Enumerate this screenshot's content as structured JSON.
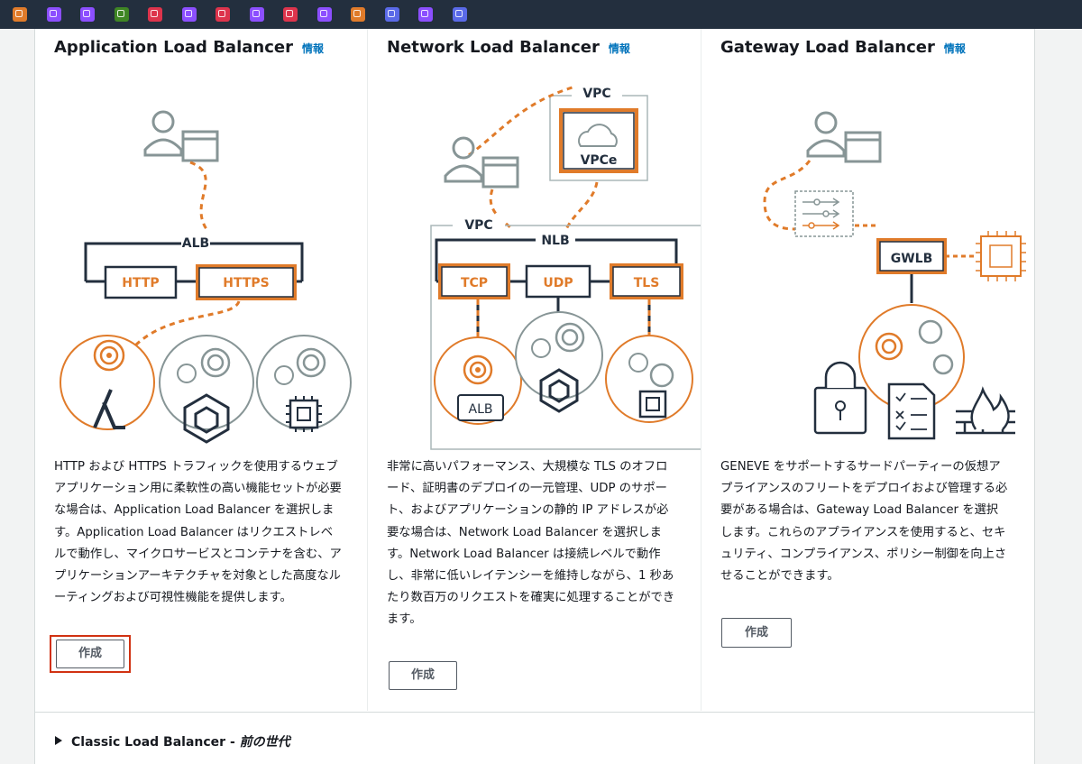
{
  "topbar": {
    "icons": [
      {
        "name": "service-icon-1",
        "color": "#e07b2a"
      },
      {
        "name": "service-icon-2",
        "color": "#8c4fff"
      },
      {
        "name": "service-icon-3",
        "color": "#8c4fff"
      },
      {
        "name": "service-icon-4",
        "color": "#3f8624"
      },
      {
        "name": "service-icon-5",
        "color": "#dd344c"
      },
      {
        "name": "service-icon-6",
        "color": "#8c4fff"
      },
      {
        "name": "service-icon-7",
        "color": "#dd344c"
      },
      {
        "name": "service-icon-8",
        "color": "#8c4fff"
      },
      {
        "name": "service-icon-9",
        "color": "#dd344c"
      },
      {
        "name": "service-icon-10",
        "color": "#8c4fff"
      },
      {
        "name": "lambda-service-icon",
        "color": "#e07b2a"
      },
      {
        "name": "service-icon-12",
        "color": "#5a6ae8"
      },
      {
        "name": "service-icon-13",
        "color": "#8c4fff"
      },
      {
        "name": "service-icon-14",
        "color": "#5a6ae8"
      }
    ]
  },
  "colors": {
    "accent": "#e07b2a",
    "link": "#0073bb",
    "highlight": "#d13212"
  },
  "cards": [
    {
      "title": "Application Load Balancer",
      "info": "情報",
      "diagram": {
        "group": "ALB",
        "protocols": [
          "HTTP",
          "HTTPS"
        ]
      },
      "description": "HTTP および HTTPS トラフィックを使用するウェブアプリケーション用に柔軟性の高い機能セットが必要な場合は、Application Load Balancer を選択します。Application Load Balancer はリクエストレベルで動作し、マイクロサービスとコンテナを含む、アプリケーションアーキテクチャを対象とした高度なルーティングおよび可視性機能を提供します。",
      "button": "作成"
    },
    {
      "title": "Network Load Balancer",
      "info": "情報",
      "diagram": {
        "vpc_top": "VPC",
        "vpce": "VPCe",
        "vpc": "VPC",
        "group": "NLB",
        "protocols": [
          "TCP",
          "UDP",
          "TLS"
        ],
        "target": "ALB"
      },
      "description": "非常に高いパフォーマンス、大規模な TLS のオフロード、証明書のデプロイの一元管理、UDP のサポート、およびアプリケーションの静的 IP アドレスが必要な場合は、Network Load Balancer を選択します。Network Load Balancer は接続レベルで動作し、非常に低いレイテンシーを維持しながら、1 秒あたり数百万のリクエストを確実に処理することができます。",
      "button": "作成"
    },
    {
      "title": "Gateway Load Balancer",
      "info": "情報",
      "diagram": {
        "group": "GWLB"
      },
      "description": "GENEVE をサポートするサードパーティーの仮想アプライアンスのフリートをデプロイおよび管理する必要がある場合は、Gateway Load Balancer を選択します。これらのアプライアンスを使用すると、セキュリティ、コンプライアンス、ポリシー制御を向上させることができます。",
      "button": "作成"
    }
  ],
  "classic": {
    "label": "Classic Load Balancer - ",
    "suffix": "前の世代"
  }
}
